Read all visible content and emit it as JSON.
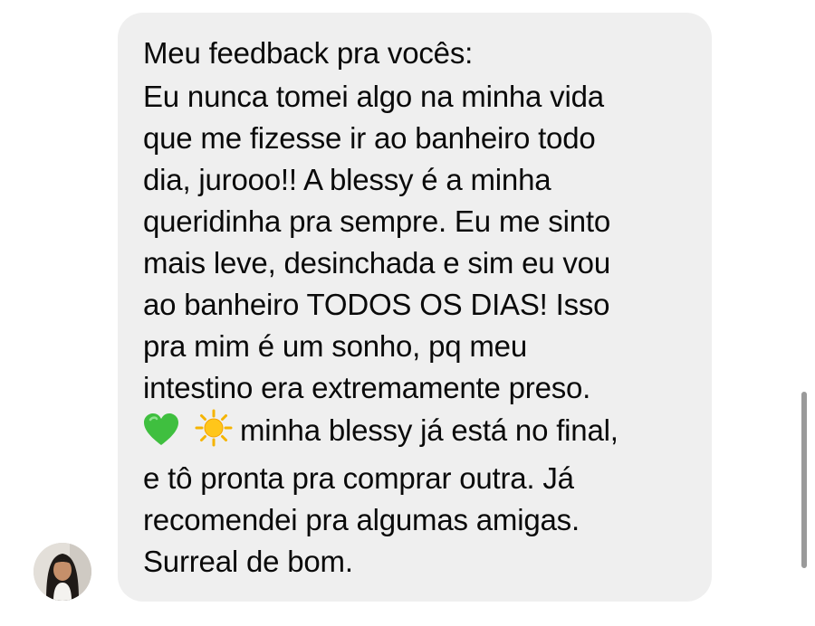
{
  "message": {
    "lines": [
      "Meu feedback pra vocês:",
      "Eu nunca tomei algo na minha vida",
      "que me fizesse ir ao banheiro todo",
      "dia, jurooo!! A blessy é a minha",
      "queridinha pra sempre. Eu me sinto",
      "mais leve, desinchada e sim eu vou",
      "ao banheiro TODOS OS DIAS! Isso",
      "pra mim é um sonho, pq meu",
      "intestino era extremamente preso.",
      "minha blessy já está no final,",
      "e tô pronta pra comprar outra. Já",
      "recomendei pra algumas amigas.",
      "Surreal de bom."
    ],
    "emojis": [
      "green-heart-icon",
      "sun-icon"
    ]
  },
  "colors": {
    "bubble": "#efefef",
    "text": "#0a0a0a",
    "heart": "#3fbf3f",
    "sun": "#f5b400"
  }
}
